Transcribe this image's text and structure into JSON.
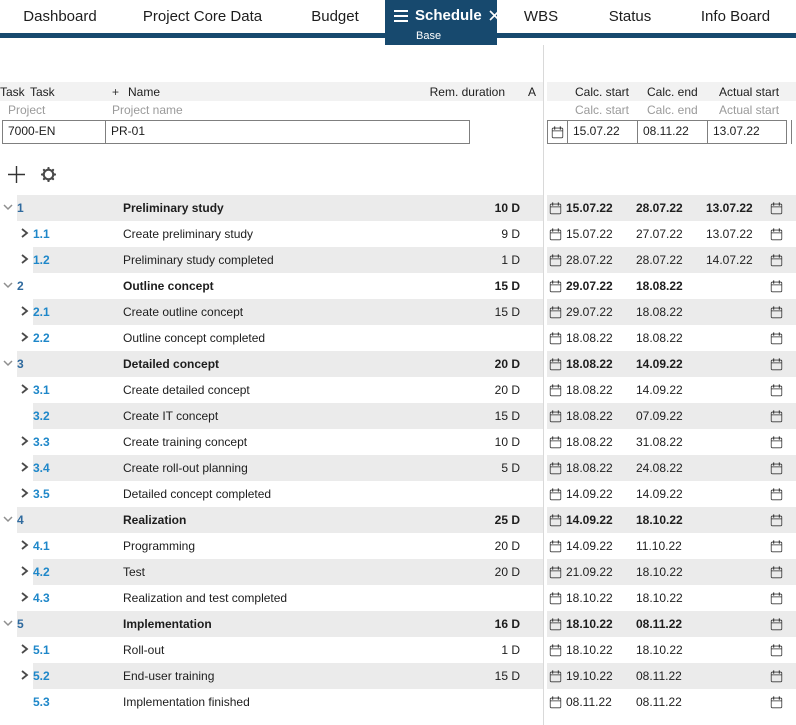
{
  "colors": {
    "navy": "#17496e",
    "row_grey": "#ebebeb",
    "strip_grey": "#f2f2f2",
    "blue_group": "#2f6a9e",
    "blue_sub": "#1e87c9",
    "muted_text": "#9a9a9a",
    "input_border": "#7f7f7f",
    "panel_line": "#d9d9d9"
  },
  "tabs": [
    {
      "label": "Dashboard"
    },
    {
      "label": "Project Core Data"
    },
    {
      "label": "Budget"
    },
    {
      "label": "Schedule",
      "sublabel": "Base",
      "active": true
    },
    {
      "label": "WBS"
    },
    {
      "label": "Status"
    },
    {
      "label": "Info Board"
    }
  ],
  "left_panel": {
    "header": {
      "task": "Task",
      "plus": "+",
      "name": "Name",
      "rem_duration": "Rem. duration",
      "a": "A"
    },
    "subheader": {
      "project": "Project",
      "project_name": "Project name"
    },
    "inputs": {
      "task_id": "7000-EN",
      "project_name": "PR-01"
    }
  },
  "right_panel": {
    "header": {
      "calc_start": "Calc. start",
      "calc_end": "Calc. end",
      "actual_start": "Actual start"
    },
    "subheader": {
      "calc_start": "Calc. start",
      "calc_end": "Calc. end",
      "actual_start": "Actual start"
    },
    "inputs": {
      "calc_start": "15.07.22",
      "calc_end": "08.11.22",
      "actual_start": "13.07.22"
    }
  },
  "tasks": [
    {
      "num": "1",
      "name": "Preliminary study",
      "duration": "10 D",
      "calc_start": "15.07.22",
      "calc_end": "28.07.22",
      "actual_start": "13.07.22",
      "level": 1,
      "chevron": "down"
    },
    {
      "num": "1.1",
      "name": "Create preliminary study",
      "duration": "9 D",
      "calc_start": "15.07.22",
      "calc_end": "27.07.22",
      "actual_start": "13.07.22",
      "level": 2,
      "chevron": "right"
    },
    {
      "num": "1.2",
      "name": "Preliminary study completed",
      "duration": "1 D",
      "calc_start": "28.07.22",
      "calc_end": "28.07.22",
      "actual_start": "14.07.22",
      "level": 2,
      "chevron": "right"
    },
    {
      "num": "2",
      "name": "Outline concept",
      "duration": "15 D",
      "calc_start": "29.07.22",
      "calc_end": "18.08.22",
      "actual_start": "",
      "level": 1,
      "chevron": "down"
    },
    {
      "num": "2.1",
      "name": "Create outline concept",
      "duration": "15 D",
      "calc_start": "29.07.22",
      "calc_end": "18.08.22",
      "actual_start": "",
      "level": 2,
      "chevron": "right"
    },
    {
      "num": "2.2",
      "name": "Outline concept completed",
      "duration": "",
      "calc_start": "18.08.22",
      "calc_end": "18.08.22",
      "actual_start": "",
      "level": 2,
      "chevron": "right"
    },
    {
      "num": "3",
      "name": "Detailed concept",
      "duration": "20 D",
      "calc_start": "18.08.22",
      "calc_end": "14.09.22",
      "actual_start": "",
      "level": 1,
      "chevron": "down"
    },
    {
      "num": "3.1",
      "name": "Create detailed concept",
      "duration": "20 D",
      "calc_start": "18.08.22",
      "calc_end": "14.09.22",
      "actual_start": "",
      "level": 2,
      "chevron": "right"
    },
    {
      "num": "3.2",
      "name": "Create IT concept",
      "duration": "15 D",
      "calc_start": "18.08.22",
      "calc_end": "07.09.22",
      "actual_start": "",
      "level": 2,
      "chevron": "none"
    },
    {
      "num": "3.3",
      "name": "Create training concept",
      "duration": "10 D",
      "calc_start": "18.08.22",
      "calc_end": "31.08.22",
      "actual_start": "",
      "level": 2,
      "chevron": "right"
    },
    {
      "num": "3.4",
      "name": "Create roll-out planning",
      "duration": "5 D",
      "calc_start": "18.08.22",
      "calc_end": "24.08.22",
      "actual_start": "",
      "level": 2,
      "chevron": "right"
    },
    {
      "num": "3.5",
      "name": "Detailed concept completed",
      "duration": "",
      "calc_start": "14.09.22",
      "calc_end": "14.09.22",
      "actual_start": "",
      "level": 2,
      "chevron": "right"
    },
    {
      "num": "4",
      "name": "Realization",
      "duration": "25 D",
      "calc_start": "14.09.22",
      "calc_end": "18.10.22",
      "actual_start": "",
      "level": 1,
      "chevron": "down"
    },
    {
      "num": "4.1",
      "name": "Programming",
      "duration": "20 D",
      "calc_start": "14.09.22",
      "calc_end": "11.10.22",
      "actual_start": "",
      "level": 2,
      "chevron": "right"
    },
    {
      "num": "4.2",
      "name": "Test",
      "duration": "20 D",
      "calc_start": "21.09.22",
      "calc_end": "18.10.22",
      "actual_start": "",
      "level": 2,
      "chevron": "right"
    },
    {
      "num": "4.3",
      "name": "Realization and test completed",
      "duration": "",
      "calc_start": "18.10.22",
      "calc_end": "18.10.22",
      "actual_start": "",
      "level": 2,
      "chevron": "right"
    },
    {
      "num": "5",
      "name": "Implementation",
      "duration": "16 D",
      "calc_start": "18.10.22",
      "calc_end": "08.11.22",
      "actual_start": "",
      "level": 1,
      "chevron": "down"
    },
    {
      "num": "5.1",
      "name": "Roll-out",
      "duration": "1 D",
      "calc_start": "18.10.22",
      "calc_end": "18.10.22",
      "actual_start": "",
      "level": 2,
      "chevron": "right"
    },
    {
      "num": "5.2",
      "name": "End-user training",
      "duration": "15 D",
      "calc_start": "19.10.22",
      "calc_end": "08.11.22",
      "actual_start": "",
      "level": 2,
      "chevron": "right"
    },
    {
      "num": "5.3",
      "name": "Implementation finished",
      "duration": "",
      "calc_start": "08.11.22",
      "calc_end": "08.11.22",
      "actual_start": "",
      "level": 2,
      "chevron": "none"
    }
  ]
}
